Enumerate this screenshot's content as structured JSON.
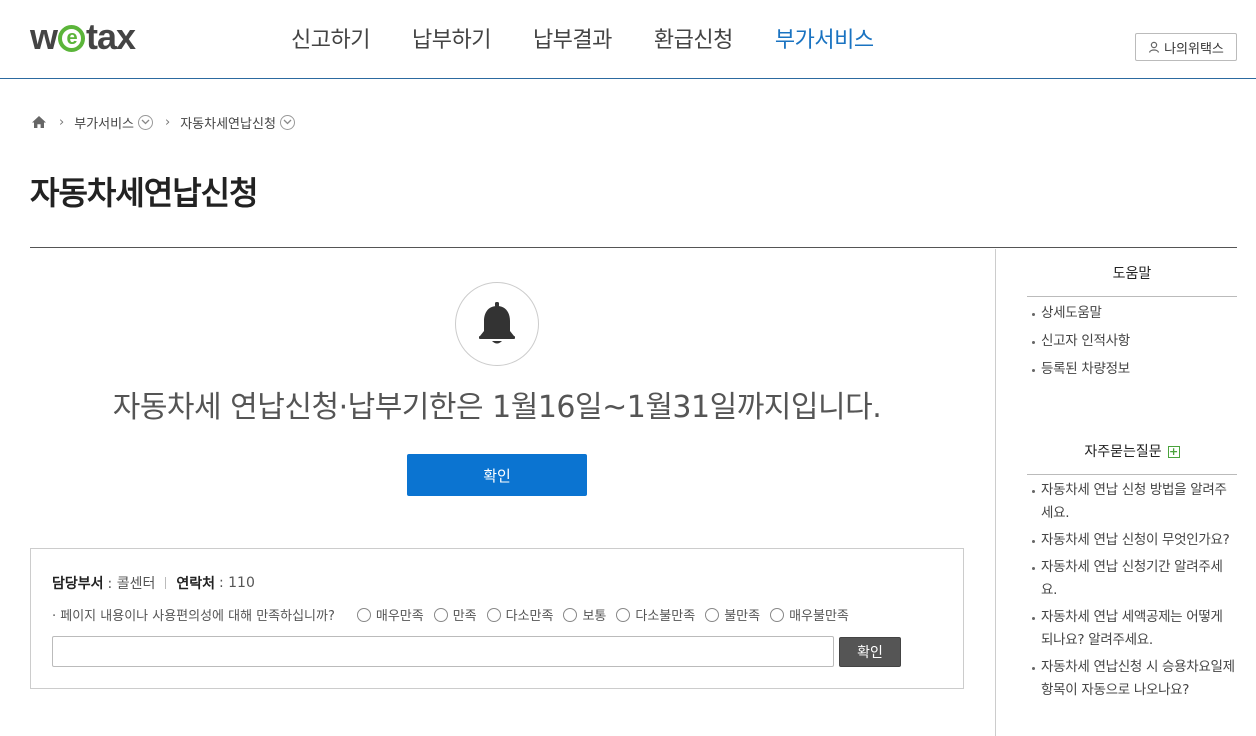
{
  "header": {
    "logo": {
      "pre": "w",
      "e": "e",
      "post": "tax"
    },
    "nav": [
      "신고하기",
      "납부하기",
      "납부결과",
      "환급신청",
      "부가서비스"
    ],
    "active_nav": "부가서비스",
    "my_wetax": "나의위택스"
  },
  "breadcrumb": {
    "items": [
      "부가서비스",
      "자동차세연납신청"
    ]
  },
  "page": {
    "title": "자동차세연납신청"
  },
  "notice": {
    "message": "자동차세 연납신청·납부기한은 1월16일~1월31일까지입니다.",
    "confirm_label": "확인"
  },
  "satisfaction": {
    "dept_label": "담당부서",
    "dept_value": ": 콜센터",
    "contact_label": "연락처",
    "contact_value": ": 110",
    "question": "· 페이지 내용이나 사용편의성에 대해 만족하십니까?",
    "options": [
      "매우만족",
      "만족",
      "다소만족",
      "보통",
      "다소불만족",
      "불만족",
      "매우불만족"
    ],
    "input_value": "",
    "submit_label": "확인"
  },
  "sidebar": {
    "help_title": "도움말",
    "help_items": [
      "상세도움말",
      "신고자 인적사항",
      "등록된 차량정보"
    ],
    "faq_title": "자주묻는질문",
    "faq_items": [
      "자동차세 연납 신청 방법을 알려주세요.",
      "자동차세 연납 신청이 무엇인가요?",
      "자동차세 연납 신청기간 알려주세요.",
      "자동차세 연납 세액공제는 어떻게 되나요? 알려주세요.",
      "자동차세 연납신청 시 승용차요일제 항목이 자동으로 나오나요?"
    ]
  },
  "colors": {
    "brand_blue": "#0b74d1",
    "nav_active": "#1a73c1",
    "logo_green": "#5bb53a"
  }
}
